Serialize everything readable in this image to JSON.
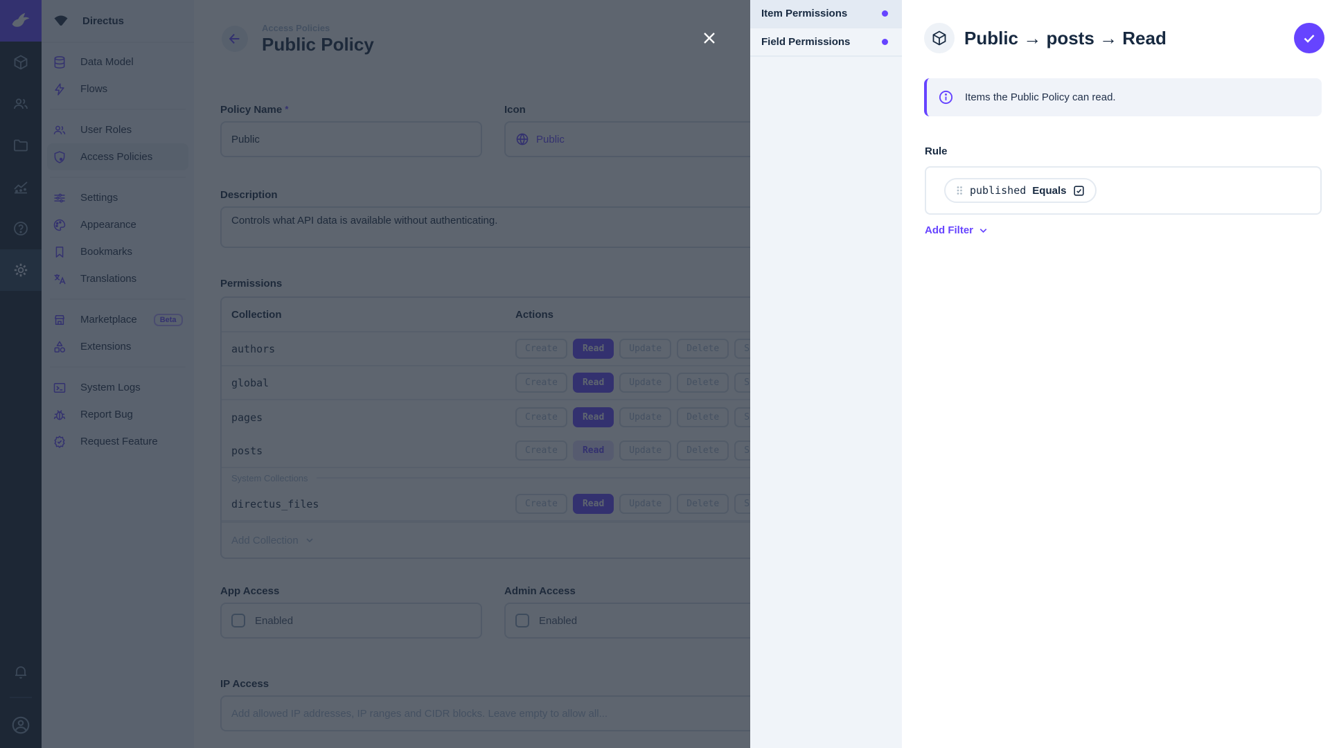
{
  "colors": {
    "accent": "#6644ff",
    "module_bar": "#18222f",
    "navy": "#172940",
    "sidebar_bg": "#f0f4f9",
    "border": "#d3dae4",
    "overlay": "rgba(32,42,56,0.72)"
  },
  "module_bar": {
    "modules": [
      {
        "name": "content",
        "icon": "cube-icon"
      },
      {
        "name": "users",
        "icon": "users-icon"
      },
      {
        "name": "files",
        "icon": "folder-icon"
      },
      {
        "name": "insights",
        "icon": "insights-icon"
      },
      {
        "name": "docs",
        "icon": "help-icon"
      },
      {
        "name": "settings",
        "icon": "gear-icon",
        "active": true
      }
    ]
  },
  "sidebar": {
    "project_name": "Directus",
    "items": [
      {
        "label": "Data Model",
        "icon": "database-icon"
      },
      {
        "label": "Flows",
        "icon": "bolt-icon",
        "divider_after": true
      },
      {
        "label": "User Roles",
        "icon": "user-roles-icon"
      },
      {
        "label": "Access Policies",
        "icon": "shield-icon",
        "active": true,
        "divider_after": true
      },
      {
        "label": "Settings",
        "icon": "tune-icon"
      },
      {
        "label": "Appearance",
        "icon": "palette-icon"
      },
      {
        "label": "Bookmarks",
        "icon": "bookmark-icon"
      },
      {
        "label": "Translations",
        "icon": "translate-icon",
        "divider_after": true
      },
      {
        "label": "Marketplace",
        "icon": "storefront-icon",
        "badge": "Beta"
      },
      {
        "label": "Extensions",
        "icon": "category-icon",
        "divider_after": true
      },
      {
        "label": "System Logs",
        "icon": "terminal-icon"
      },
      {
        "label": "Report Bug",
        "icon": "bug-icon"
      },
      {
        "label": "Request Feature",
        "icon": "feature-icon"
      }
    ]
  },
  "page": {
    "breadcrumb": "Access Policies",
    "title": "Public Policy"
  },
  "form": {
    "policy_name": {
      "label": "Policy Name",
      "required": "*",
      "value": "Public"
    },
    "icon": {
      "label": "Icon",
      "value": "Public"
    },
    "description": {
      "label": "Description",
      "value": "Controls what API data is available without authenticating."
    },
    "permissions": {
      "label": "Permissions",
      "columns": [
        "Collection",
        "Actions"
      ],
      "actions": [
        "Create",
        "Read",
        "Update",
        "Delete",
        "Share"
      ],
      "rows": [
        {
          "collection": "authors",
          "states": [
            "none",
            "full",
            "none",
            "none",
            "none"
          ]
        },
        {
          "collection": "global",
          "states": [
            "none",
            "full",
            "none",
            "none",
            "none"
          ]
        },
        {
          "collection": "pages",
          "states": [
            "none",
            "full",
            "none",
            "none",
            "none"
          ]
        },
        {
          "collection": "posts",
          "states": [
            "none",
            "custom",
            "none",
            "none",
            "none"
          ]
        }
      ],
      "system_label": "System Collections",
      "system_rows": [
        {
          "collection": "directus_files",
          "states": [
            "none",
            "full",
            "none",
            "none",
            "none"
          ]
        }
      ],
      "add_label": "Add Collection"
    },
    "app_access": {
      "label": "App Access",
      "checkbox_label": "Enabled",
      "checked": false
    },
    "admin_access": {
      "label": "Admin Access",
      "checkbox_label": "Enabled",
      "checked": false
    },
    "ip_access": {
      "label": "IP Access",
      "placeholder": "Add allowed IP addresses, IP ranges and CIDR blocks. Leave empty to allow all..."
    }
  },
  "drawer": {
    "nav": [
      {
        "label": "Item Permissions",
        "active": true
      },
      {
        "label": "Field Permissions",
        "active": false
      }
    ],
    "title": "Public → posts → Read",
    "notice": "Items the Public Policy can read.",
    "rule_label": "Rule",
    "filter": {
      "field": "published",
      "operator": "Equals",
      "value": "checked"
    },
    "add_filter_label": "Add Filter"
  }
}
